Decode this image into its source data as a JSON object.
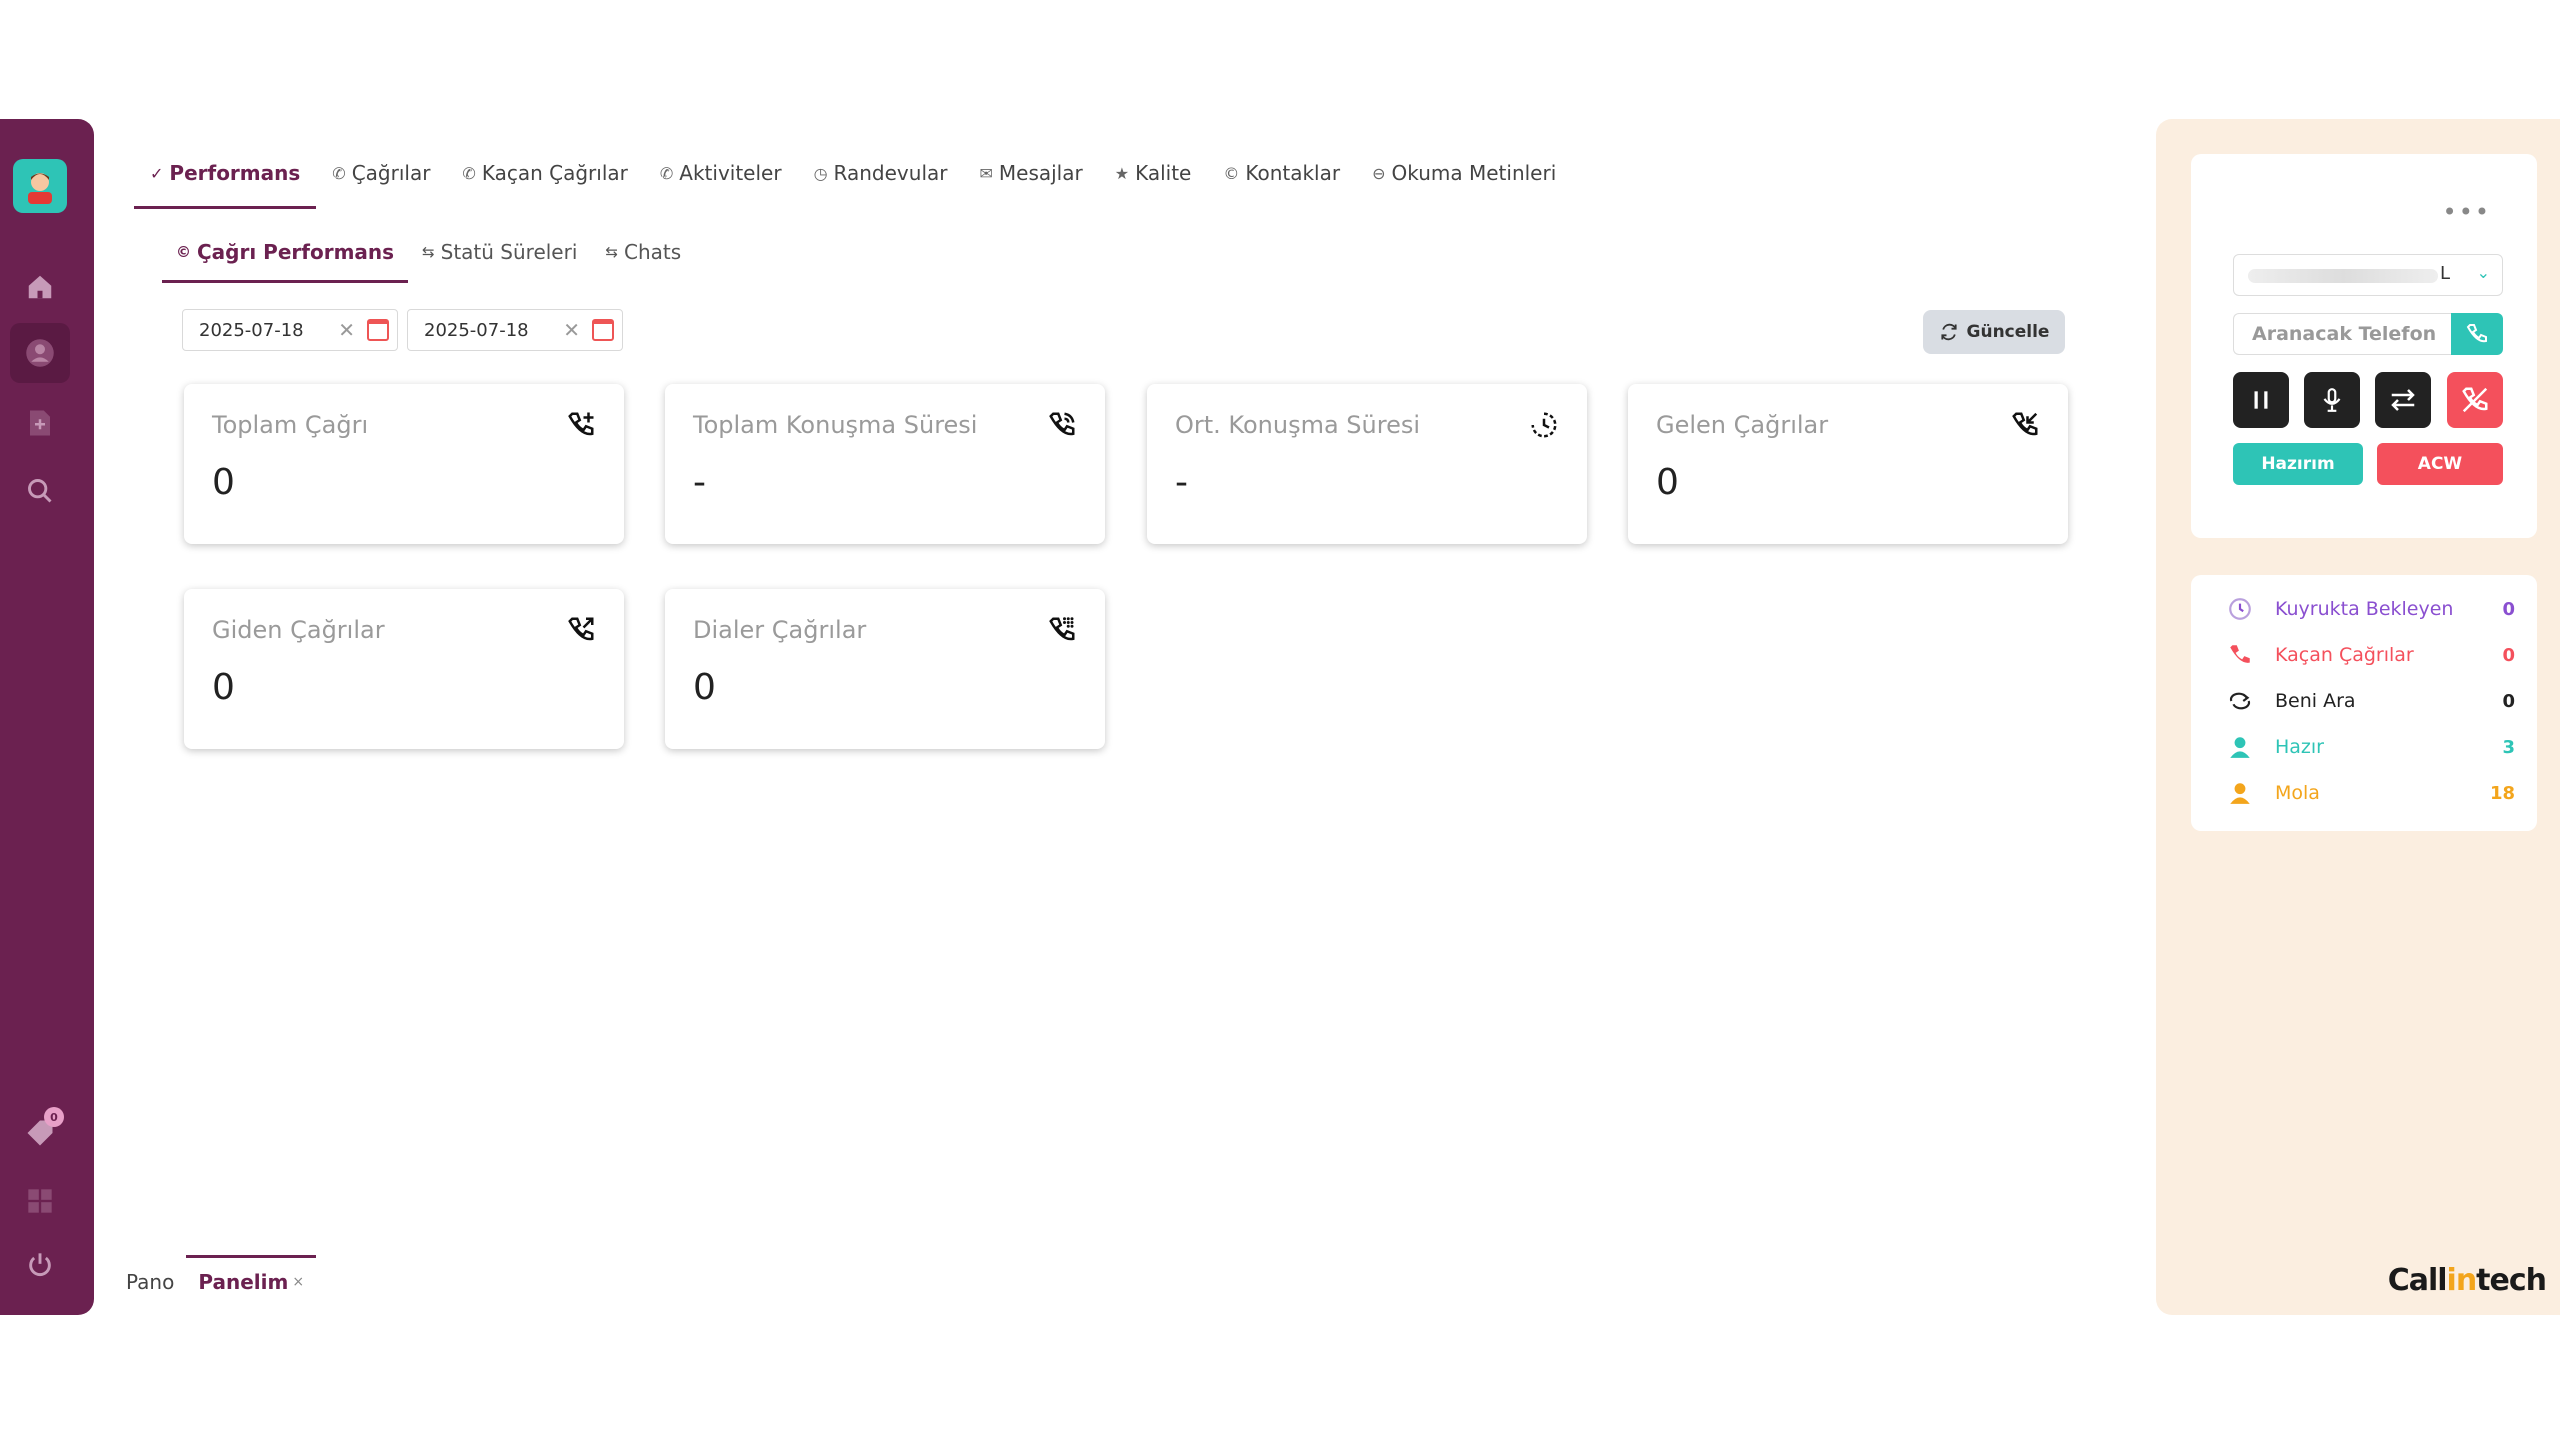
{
  "colors": {
    "brand": "#6b2150",
    "teal": "#2ec4b6",
    "red": "#f4505c",
    "panel_bg": "#fbeee0",
    "purple": "#8a4fd0",
    "orange": "#f3a51c"
  },
  "sidebar": {
    "icons": [
      "home-icon",
      "user-icon",
      "plus-file-icon",
      "search-icon",
      "tag-icon",
      "grid-icon",
      "power-icon"
    ],
    "badge": "0"
  },
  "tabs": [
    {
      "label": "Performans",
      "icon": "✓"
    },
    {
      "label": "Çağrılar",
      "icon": "✆"
    },
    {
      "label": "Kaçan Çağrılar",
      "icon": "✆"
    },
    {
      "label": "Aktiviteler",
      "icon": "✆"
    },
    {
      "label": "Randevular",
      "icon": "◷"
    },
    {
      "label": "Mesajlar",
      "icon": "✉"
    },
    {
      "label": "Kalite",
      "icon": "★"
    },
    {
      "label": "Kontaklar",
      "icon": "©"
    },
    {
      "label": "Okuma Metinleri",
      "icon": "⊖"
    }
  ],
  "subtabs": [
    {
      "label": "Çağrı Performans",
      "icon": "©"
    },
    {
      "label": "Statü Süreleri",
      "icon": "⇆"
    },
    {
      "label": "Chats",
      "icon": "⇆"
    }
  ],
  "filters": {
    "date_from": "2025-07-18",
    "date_to": "2025-07-18",
    "clear": "✕",
    "refresh_label": "Güncelle"
  },
  "cards": [
    {
      "title": "Toplam Çağrı",
      "value": "0"
    },
    {
      "title": "Toplam Konuşma Süresi",
      "value": "-"
    },
    {
      "title": "Ort. Konuşma Süresi",
      "value": "-"
    },
    {
      "title": "Gelen Çağrılar",
      "value": "0"
    },
    {
      "title": "Giden Çağrılar",
      "value": "0"
    },
    {
      "title": "Dialer Çağrılar",
      "value": "0"
    }
  ],
  "bottom_tabs": [
    {
      "label": "Pano"
    },
    {
      "label": "Panelim",
      "close": "×"
    }
  ],
  "softphone": {
    "menu": "•••",
    "select_value": "L",
    "phone_placeholder": "Aranacak Telefon",
    "ready_label": "Hazırım",
    "acw_label": "ACW"
  },
  "queue": [
    {
      "label": "Kuyrukta Bekleyen",
      "value": "0",
      "color": "#8a4fd0"
    },
    {
      "label": "Kaçan Çağrılar",
      "value": "0",
      "color": "#f4505c"
    },
    {
      "label": "Beni Ara",
      "value": "0",
      "color": "#222222"
    },
    {
      "label": "Hazır",
      "value": "3",
      "color": "#2ec4b6"
    },
    {
      "label": "Mola",
      "value": "18",
      "color": "#f3a51c"
    }
  ],
  "logo": {
    "part1": "Call",
    "part2": "in",
    "part3": "tech"
  }
}
